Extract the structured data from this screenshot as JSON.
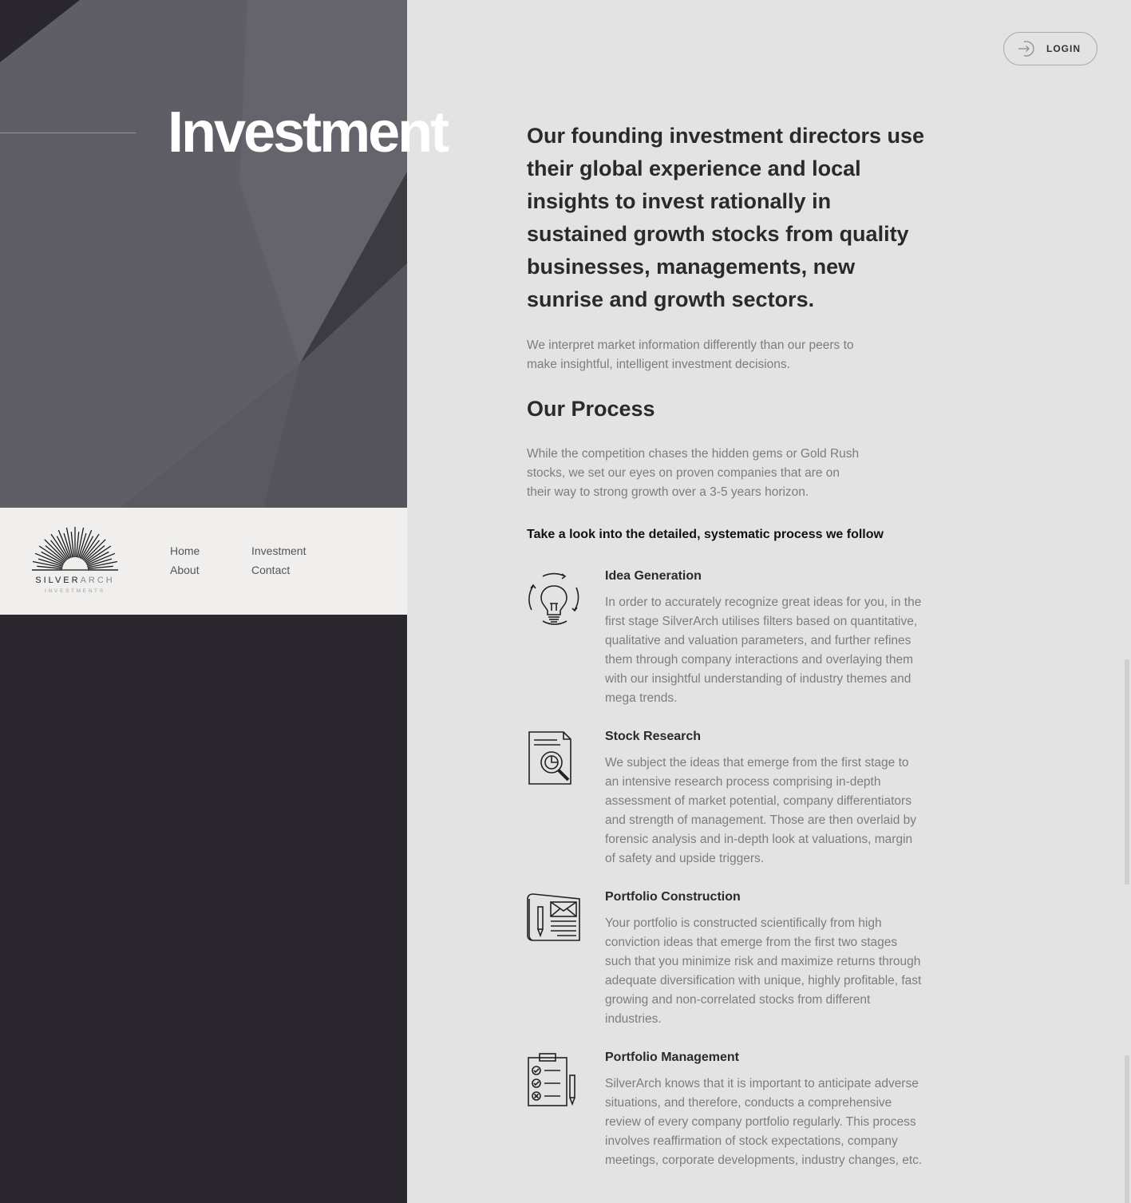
{
  "hero": {
    "title": "Investment"
  },
  "brand": {
    "name_part1": "SILVER",
    "name_part2": "ARCH",
    "tagline": "INVESTMENTS"
  },
  "nav": {
    "home": "Home",
    "investment": "Investment",
    "about": "About",
    "contact": "Contact"
  },
  "header": {
    "login_label": "LOGIN"
  },
  "intro": {
    "lead": "Our founding investment directors use their global experience and local insights to invest rationally in sustained growth stocks from quality businesses, managements, new sunrise and growth sectors.",
    "body": "We interpret market information differently than our peers to make insightful, intelligent investment decisions."
  },
  "process": {
    "title": "Our Process",
    "intro": "While the competition chases the hidden gems or Gold Rush stocks, we set our eyes on proven companies that are on their way to strong growth over a 3-5 years horizon.",
    "cta": "Take a look into the detailed, systematic process we follow",
    "steps": [
      {
        "icon": "lightbulb-icon",
        "title": "Idea Generation",
        "description": "In order to accurately recognize great ideas for you, in the first stage SilverArch utilises filters based on quantitative, qualitative and valuation parameters, and further refines them through company interactions and overlaying them with our insightful understanding of industry themes and mega trends."
      },
      {
        "icon": "research-document-icon",
        "title": "Stock Research",
        "description": "We subject the ideas that emerge from the first stage to an intensive research process comprising in-depth assessment of market potential, company differentiators and strength of management. Those are then overlaid by forensic analysis and in-depth look at valuations, margin of safety and upside triggers."
      },
      {
        "icon": "blueprint-icon",
        "title": "Portfolio Construction",
        "description": "Your portfolio is constructed scientifically from high conviction ideas that emerge from the first two stages such that you minimize risk and maximize returns through adequate diversification with unique, highly profitable, fast growing and non-correlated stocks from different industries."
      },
      {
        "icon": "checklist-clipboard-icon",
        "title": "Portfolio Management",
        "description": "SilverArch knows that it is important to anticipate adverse situations, and therefore, conducts a comprehensive review of every company portfolio regularly. This process involves reaffirmation of stock expectations, company meetings, corporate developments, industry changes, etc."
      }
    ]
  },
  "colors": {
    "left_dark": "#29272d",
    "hero_gray": "#5f5e67",
    "right_bg": "#e3e3e3",
    "nav_box_bg": "#f1efed",
    "heading": "#2a2a2d",
    "body_text": "#7d7d7d"
  }
}
